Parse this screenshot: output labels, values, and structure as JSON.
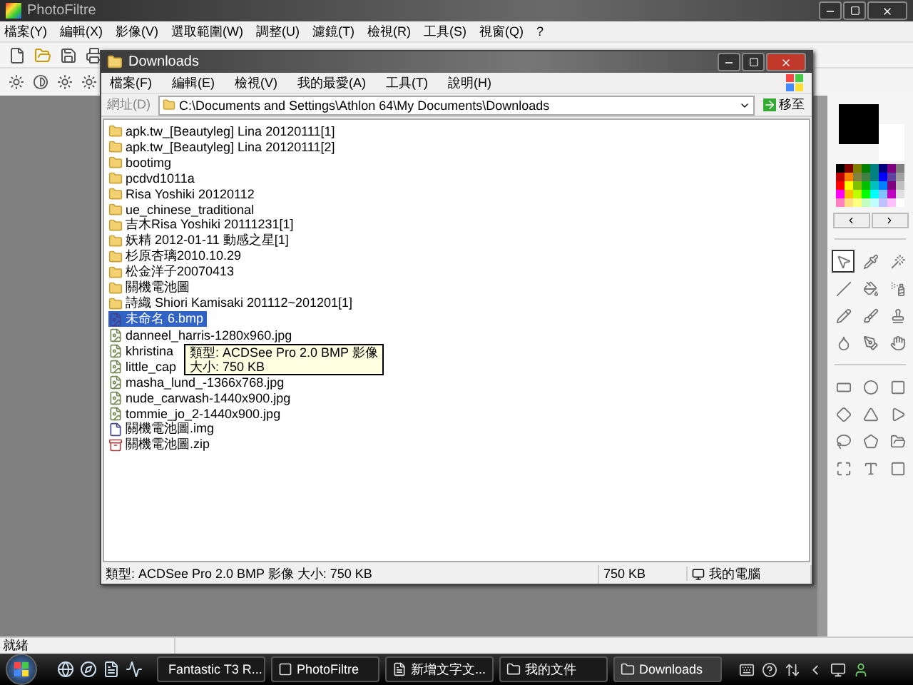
{
  "app": {
    "title": "PhotoFiltre",
    "menu": [
      "檔案(Y)",
      "編輯(X)",
      "影像(V)",
      "選取範圍(W)",
      "調整(U)",
      "濾鏡(T)",
      "檢視(R)",
      "工具(S)",
      "視窗(Q)",
      "?"
    ],
    "status": "就緒"
  },
  "explorer": {
    "title": "Downloads",
    "menu": [
      "檔案(F)",
      "編輯(E)",
      "檢視(V)",
      "我的最愛(A)",
      "工具(T)",
      "說明(H)"
    ],
    "address_label": "網址(D)",
    "address": "C:\\Documents and Settings\\Athlon 64\\My Documents\\Downloads",
    "go_button": "移至",
    "files": [
      {
        "name": "apk.tw_[Beautyleg] Lina 20120111[1]",
        "kind": "folder",
        "selected": false
      },
      {
        "name": "apk.tw_[Beautyleg] Lina 20120111[2]",
        "kind": "folder",
        "selected": false
      },
      {
        "name": "bootimg",
        "kind": "folder",
        "selected": false
      },
      {
        "name": "pcdvd1011a",
        "kind": "folder",
        "selected": false
      },
      {
        "name": "Risa Yoshiki 20120112",
        "kind": "folder",
        "selected": false
      },
      {
        "name": "ue_chinese_traditional",
        "kind": "folder",
        "selected": false
      },
      {
        "name": "吉木Risa Yoshiki 20111231[1]",
        "kind": "folder",
        "selected": false
      },
      {
        "name": "妖精 2012-01-11 動感之星[1]",
        "kind": "folder",
        "selected": false
      },
      {
        "name": "杉原杏璃2010.10.29",
        "kind": "folder",
        "selected": false
      },
      {
        "name": "松金洋子20070413",
        "kind": "folder",
        "selected": false
      },
      {
        "name": "關機電池圖",
        "kind": "folder",
        "selected": false
      },
      {
        "name": "詩織 Shiori Kamisaki 201112~201201[1]",
        "kind": "folder",
        "selected": false
      },
      {
        "name": "未命名 6.bmp",
        "kind": "bmp",
        "selected": true
      },
      {
        "name": "danneel_harris-1280x960.jpg",
        "kind": "jpg",
        "selected": false
      },
      {
        "name": "khristina",
        "kind": "jpg",
        "selected": false
      },
      {
        "name": "little_cap",
        "kind": "jpg",
        "selected": false
      },
      {
        "name": "masha_lund_-1366x768.jpg",
        "kind": "jpg",
        "selected": false
      },
      {
        "name": "nude_carwash-1440x900.jpg",
        "kind": "jpg",
        "selected": false
      },
      {
        "name": "tommie_jo_2-1440x900.jpg",
        "kind": "jpg",
        "selected": false
      },
      {
        "name": "關機電池圖.img",
        "kind": "img",
        "selected": false
      },
      {
        "name": "關機電池圖.zip",
        "kind": "zip",
        "selected": false
      }
    ],
    "tooltip": [
      "類型: ACDSee Pro 2.0 BMP 影像",
      "大小: 750 KB"
    ],
    "status": [
      "類型: ACDSee Pro 2.0 BMP 影像 大小: 750 KB",
      "750 KB",
      "我的電腦"
    ]
  },
  "panel": {
    "tools": [
      {
        "selected": true
      },
      {
        "selected": false
      },
      {
        "selected": false
      },
      {
        "selected": false
      },
      {
        "selected": false
      },
      {
        "selected": false
      },
      {
        "selected": false
      },
      {
        "selected": false
      },
      {
        "selected": false
      },
      {
        "selected": false
      },
      {
        "selected": false
      },
      {
        "selected": false
      }
    ],
    "shapes": [
      {
        "selected": false
      },
      {
        "selected": false
      },
      {
        "selected": false
      },
      {
        "selected": false
      },
      {
        "selected": false
      },
      {
        "selected": false
      },
      {
        "selected": false
      },
      {
        "selected": false
      },
      {
        "selected": false
      },
      {
        "selected": false
      },
      {
        "selected": false
      },
      {
        "selected": false
      }
    ]
  },
  "taskbar": [
    {
      "label": "Fantastic T3 R...",
      "selected": false
    },
    {
      "label": "PhotoFiltre",
      "selected": false
    },
    {
      "label": "新增文字文...",
      "selected": false
    },
    {
      "label": "我的文件",
      "selected": false
    },
    {
      "label": "Downloads",
      "selected": true
    }
  ]
}
